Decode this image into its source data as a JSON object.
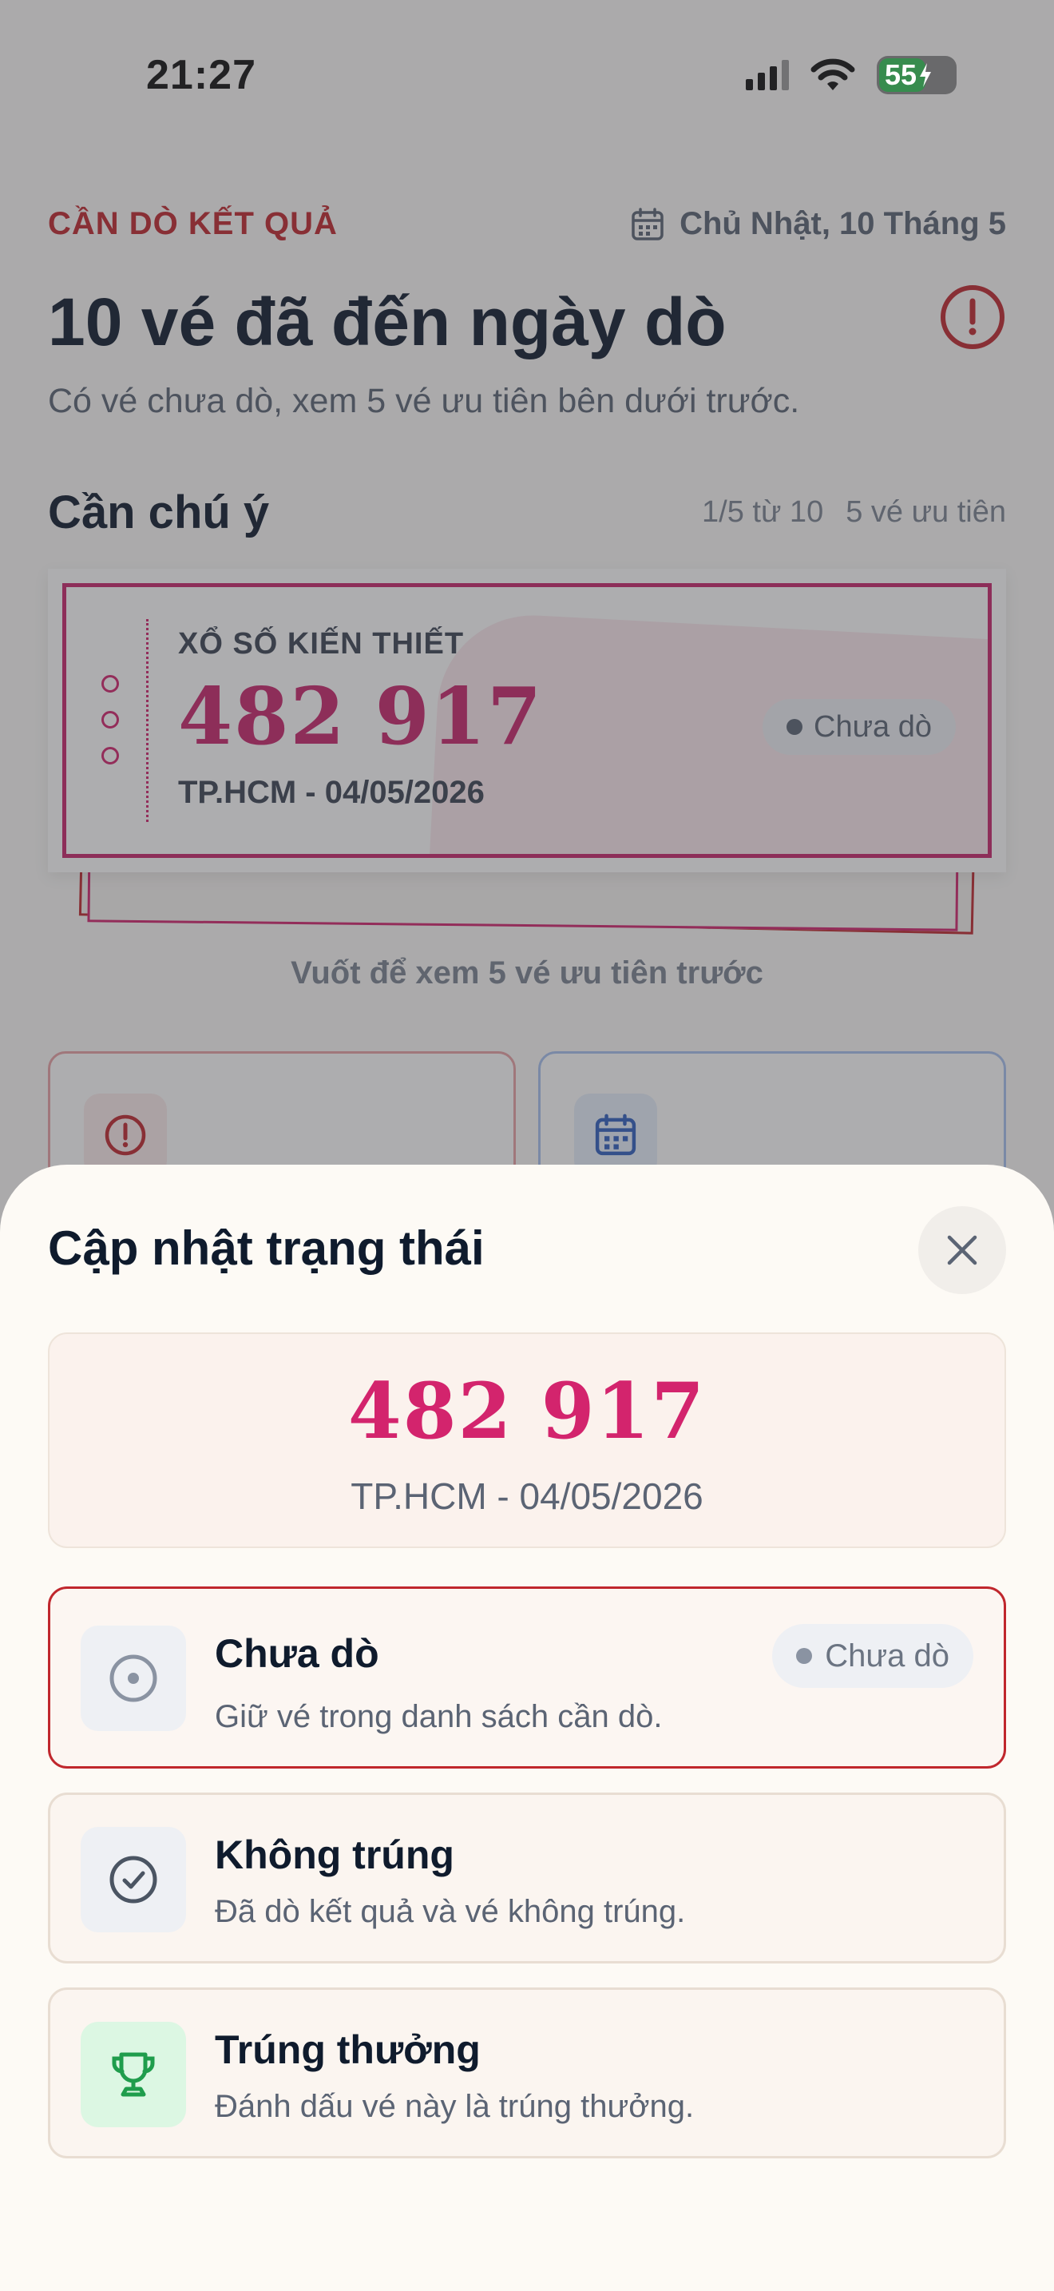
{
  "status_bar": {
    "time": "21:27",
    "battery": "55"
  },
  "header": {
    "kicker": "CẦN DÒ KẾT QUẢ",
    "date": "Chủ Nhật, 10 Tháng 5",
    "title": "10 vé đã đến ngày dò",
    "subtitle": "Có vé chưa dò, xem 5 vé ưu tiên bên dưới trước."
  },
  "attention": {
    "title": "Cần chú ý",
    "position": "1/5 từ 10",
    "priority": "5 vé ưu tiên"
  },
  "ticket_card": {
    "label": "XỔ SỐ KIẾN THIẾT",
    "number": "482 917",
    "sub": "TP.HCM - 04/05/2026",
    "status": "Chưa dò"
  },
  "swipe_hint": "Vuốt để xem 5 vé ưu tiên trước",
  "sheet": {
    "title": "Cập nhật trạng thái",
    "ticket_number": "482 917",
    "ticket_sub": "TP.HCM - 04/05/2026",
    "options": [
      {
        "title": "Chưa dò",
        "desc": "Giữ vé trong danh sách cần dò.",
        "badge": "Chưa dò"
      },
      {
        "title": "Không trúng",
        "desc": "Đã dò kết quả và vé không trúng."
      },
      {
        "title": "Trúng thưởng",
        "desc": "Đánh dấu vé này là trúng thưởng."
      }
    ]
  },
  "colors": {
    "accent_red": "#c0272d",
    "ticket_pink": "#c8256b",
    "win_green": "#1f9d4c"
  }
}
